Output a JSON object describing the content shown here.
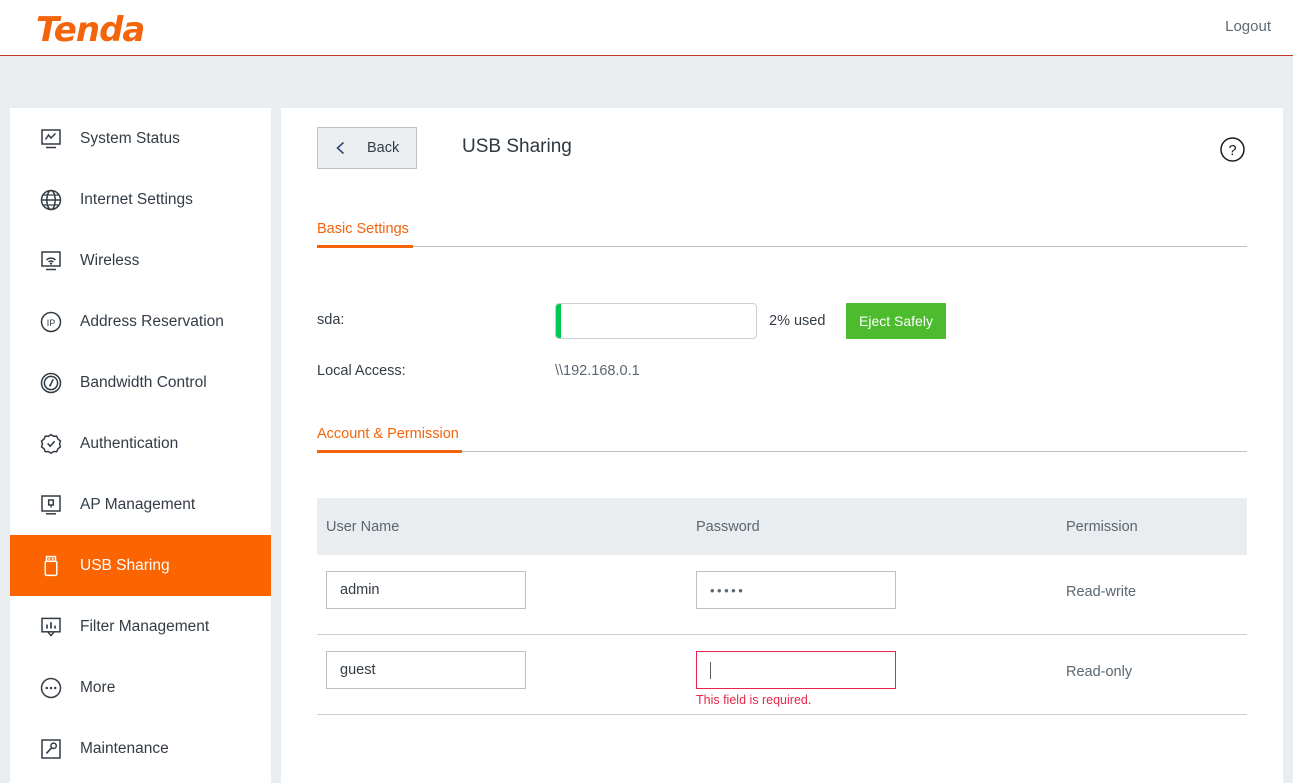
{
  "header": {
    "logo_text": "Tenda",
    "logout_label": "Logout",
    "accent_color": "#f4640a",
    "rule_color": "#c0392b"
  },
  "sidebar": {
    "active_index": 7,
    "active_color": "#fb6400",
    "items": [
      {
        "label": "System Status",
        "icon": "monitor-chart-icon"
      },
      {
        "label": "Internet Settings",
        "icon": "globe-icon"
      },
      {
        "label": "Wireless",
        "icon": "wifi-monitor-icon"
      },
      {
        "label": "Address Reservation",
        "icon": "ip-circle-icon"
      },
      {
        "label": "Bandwidth Control",
        "icon": "gauge-icon"
      },
      {
        "label": "Authentication",
        "icon": "badge-check-icon"
      },
      {
        "label": "AP Management",
        "icon": "access-point-icon"
      },
      {
        "label": "USB Sharing",
        "icon": "usb-drive-icon"
      },
      {
        "label": "Filter Management",
        "icon": "filter-chart-icon"
      },
      {
        "label": "More",
        "icon": "ellipsis-circle-icon"
      },
      {
        "label": "Maintenance",
        "icon": "wrench-icon"
      }
    ]
  },
  "main": {
    "back_label": "Back",
    "title": "USB Sharing",
    "help_icon": "question-circle-icon",
    "tabs": [
      {
        "label": "Basic Settings",
        "active": true
      },
      {
        "label": "Account & Permission",
        "active": true
      }
    ],
    "basic": {
      "disk_label": "sda:",
      "used_percent": 2,
      "used_label": "2% used",
      "progress_fill_color": "#00c853",
      "eject_label": "Eject Safely",
      "eject_color": "#4cbb2e",
      "local_access_label": "Local Access:",
      "local_access_value": "\\\\192.168.0.1"
    },
    "account": {
      "columns": [
        "User Name",
        "Password",
        "Permission"
      ],
      "rows": [
        {
          "user_name": "admin",
          "password_masked": "•••••",
          "password_length": 5,
          "permission": "Read-write",
          "has_error": false,
          "error_text": ""
        },
        {
          "user_name": "guest",
          "password_masked": "",
          "password_length": 0,
          "permission": "Read-only",
          "has_error": true,
          "error_text": "This field is required.",
          "error_color": "#e8264a"
        }
      ]
    }
  }
}
